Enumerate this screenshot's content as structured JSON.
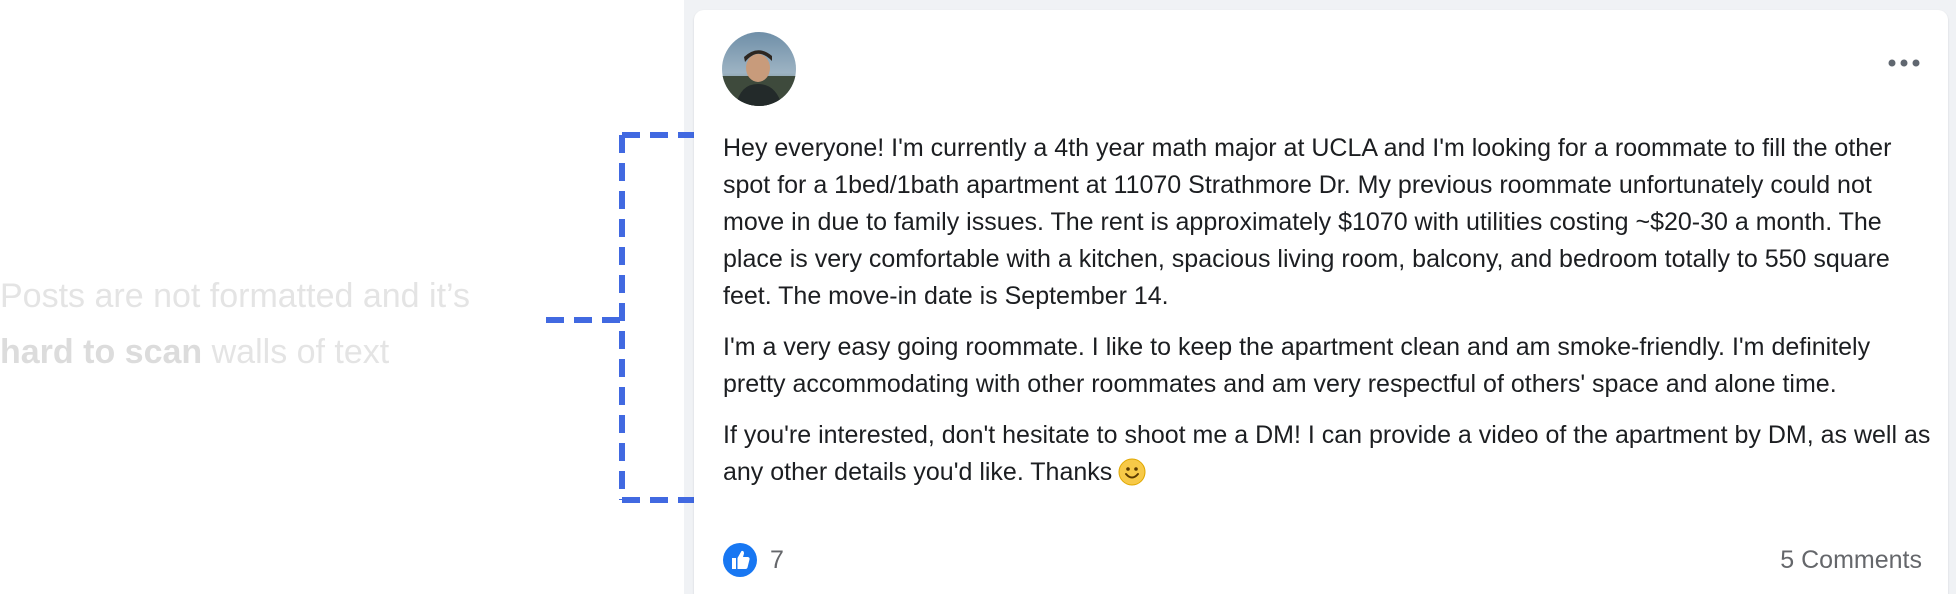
{
  "annotation": {
    "line1": "Posts are not formatted and it’s",
    "line2_bold": "hard to scan",
    "line2_rest": " walls of text"
  },
  "post": {
    "more_icon": "more-horizontal-icon",
    "avatar_icon": "user-photo",
    "paragraphs": [
      "Hey everyone! I'm currently a 4th year math major at UCLA and I'm looking for a roommate to fill the other spot for a 1bed/1bath apartment at 11070 Strathmore Dr. My previous roommate unfortunately could not move in due to family issues. The rent is approximately $1070 with utilities costing ~$20-30 a month. The place is very comfortable with a kitchen, spacious living room, balcony, and bedroom totally to 550 square feet. The move-in date is September 14.",
      "I'm a very easy going roommate. I like to keep the apartment clean and am smoke-friendly. I'm definitely pretty accommodating with other roommates and am very respectful of others' space and alone time.",
      "If you're interested, don't hesitate to shoot me a DM! I can provide a video of the apartment by DM, as well as any other details you'd like. Thanks"
    ],
    "emoji": "smiling-face-emoji",
    "like_icon": "thumbs-up-icon",
    "like_count": "7",
    "comments": "5 Comments"
  },
  "colors": {
    "bracket": "#4169e1",
    "like_blue": "#1877f2",
    "annotation_text": "#e4e4e4",
    "feed_background": "#f0f2f5"
  }
}
